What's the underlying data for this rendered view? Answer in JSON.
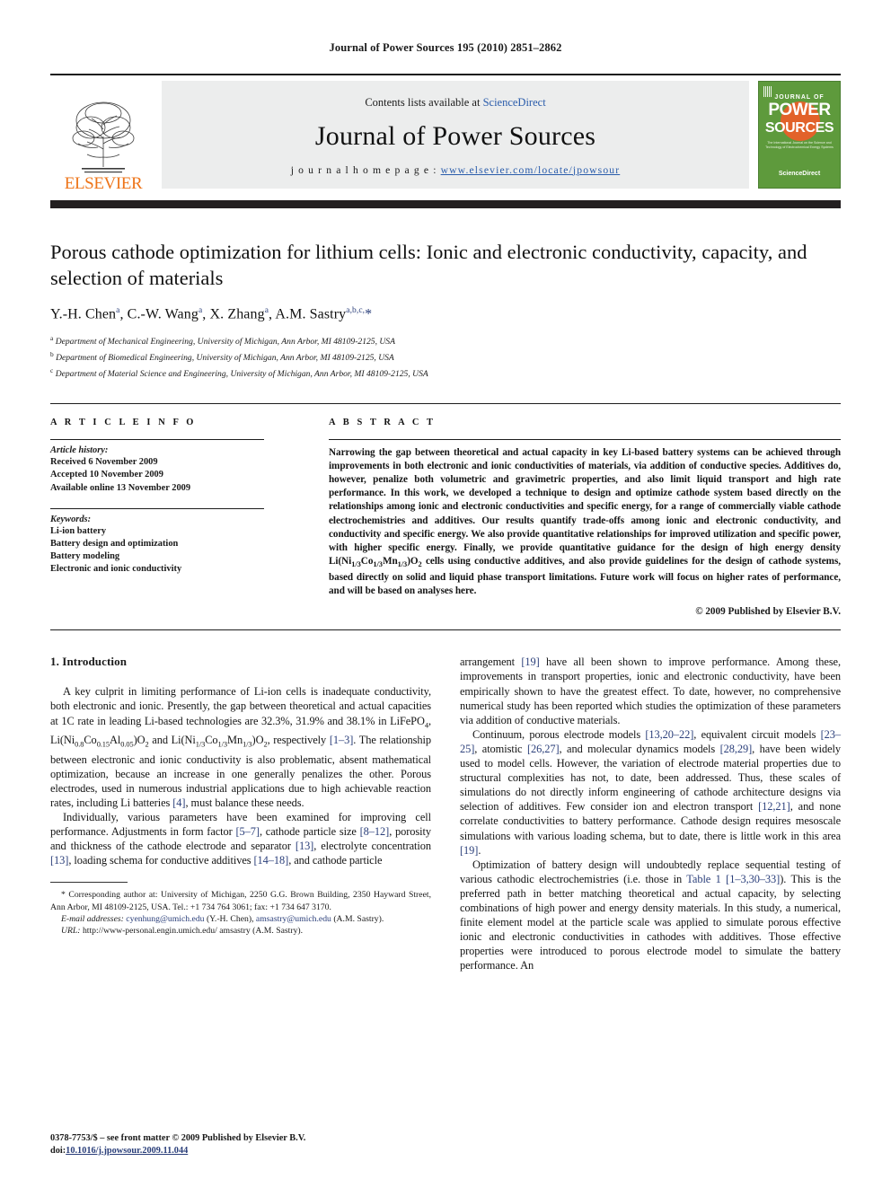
{
  "running_head": "Journal of Power Sources 195 (2010) 2851–2862",
  "masthead": {
    "publisher_name": "ELSEVIER",
    "contents_prefix": "Contents lists available at ",
    "sciencedirect": "ScienceDirect",
    "journal_title": "Journal of Power Sources",
    "homepage_prefix": "j o u r n a l   h o m e p a g e :  ",
    "homepage_url": "www.elsevier.com/locate/jpowsour",
    "cover": {
      "journal_of": "JOURNAL OF",
      "power": "POWER",
      "sources": "SOURCES",
      "subtitle": "The International Journal on the Science and Technology of Electrochemical Energy Systems",
      "sciencedirect": "ScienceDirect",
      "green": "#5e9a3c",
      "orange": "#e2622a"
    }
  },
  "article": {
    "title": "Porous cathode optimization for lithium cells: Ionic and electronic conductivity, capacity, and selection of materials",
    "authors_html": "Y.-H. Chen<sup>a</sup>, C.-W. Wang<sup>a</sup>, X. Zhang<sup>a</sup>, A.M. Sastry<sup>a,b,c,</sup><span class=\"star\">*</span>",
    "affiliations": [
      {
        "mark": "a",
        "text": "Department of Mechanical Engineering, University of Michigan, Ann Arbor, MI 48109-2125, USA"
      },
      {
        "mark": "b",
        "text": "Department of Biomedical Engineering, University of Michigan, Ann Arbor, MI 48109-2125, USA"
      },
      {
        "mark": "c",
        "text": "Department of Material Science and Engineering, University of Michigan, Ann Arbor, MI 48109-2125, USA"
      }
    ]
  },
  "article_info": {
    "label": "A R T I C L E    I N F O",
    "history_head": "Article history:",
    "history": [
      "Received 6 November 2009",
      "Accepted 10 November 2009",
      "Available online 13 November 2009"
    ],
    "keywords_head": "Keywords:",
    "keywords": [
      "Li-ion battery",
      "Battery design and optimization",
      "Battery modeling",
      "Electronic and ionic conductivity"
    ]
  },
  "abstract": {
    "label": "A B S T R A C T",
    "html": "Narrowing the gap between theoretical and actual capacity in key Li-based battery systems can be achieved through improvements in both electronic and ionic conductivities of materials, via addition of conductive species. Additives do, however, penalize both volumetric and gravimetric properties, and also limit liquid transport and high rate performance. In this work, we developed a technique to design and optimize cathode system based directly on the relationships among ionic and electronic conductivities and specific energy, for a range of commercially viable cathode electrochemistries and additives. Our results quantify trade-offs among ionic and electronic conductivity, and conductivity and specific energy. We also provide quantitative relationships for improved utilization and specific power, with higher specific energy. Finally, we provide quantitative guidance for the design of high energy density Li(Ni<sub>1/3</sub>Co<sub>1/3</sub>Mn<sub>1/3</sub>)O<sub>2</sub> cells using conductive additives, and also provide guidelines for the design of cathode systems, based directly on solid and liquid phase transport limitations. Future work will focus on higher rates of performance, and will be based on analyses here.",
    "copyright": "© 2009 Published by Elsevier B.V."
  },
  "body": {
    "section_heading": "1.  Introduction",
    "left_paragraphs_html": [
      "A key culprit in limiting performance of Li-ion cells is inadequate conductivity, both electronic and ionic. Presently, the gap between theoretical and actual capacities at 1C rate in leading Li-based technologies are 32.3%, 31.9% and 38.1% in LiFePO<sub>4</sub>, Li(Ni<sub>0.8</sub>Co<sub>0.15</sub>Al<sub>0.05</sub>)O<sub>2</sub> and Li(Ni<sub>1/3</sub>Co<sub>1/3</sub>Mn<sub>1/3</sub>)O<sub>2</sub>, respectively <span class=\"ref\">[1–3]</span>. The relationship between electronic and ionic conductivity is also problematic, absent mathematical optimization, because an increase in one generally penalizes the other. Porous electrodes, used in numerous industrial applications due to high achievable reaction rates, including Li batteries <span class=\"ref\">[4]</span>, must balance these needs.",
      "Individually, various parameters have been examined for improving cell performance. Adjustments in form factor <span class=\"ref\">[5–7]</span>, cathode particle size <span class=\"ref\">[8–12]</span>, porosity and thickness of the cathode electrode and separator <span class=\"ref\">[13]</span>, electrolyte concentration <span class=\"ref\">[13]</span>, loading schema for conductive additives <span class=\"ref\">[14–18]</span>, and cathode particle"
    ],
    "right_paragraphs_html": [
      "arrangement <span class=\"ref\">[19]</span> have all been shown to improve performance. Among these, improvements in transport properties, ionic and electronic conductivity, have been empirically shown to have the greatest effect. To date, however, no comprehensive numerical study has been reported which studies the optimization of these parameters via addition of conductive materials.",
      "Continuum, porous electrode models <span class=\"ref\">[13,20–22]</span>, equivalent circuit models <span class=\"ref\">[23–25]</span>, atomistic <span class=\"ref\">[26,27]</span>, and molecular dynamics models <span class=\"ref\">[28,29]</span>, have been widely used to model cells. However, the variation of electrode material properties due to structural complexities has not, to date, been addressed. Thus, these scales of simulations do not directly inform engineering of cathode architecture designs via selection of additives. Few consider ion and electron transport <span class=\"ref\">[12,21]</span>, and none correlate conductivities to battery performance. Cathode design requires mesoscale simulations with various loading schema, but to date, there is little work in this area <span class=\"ref\">[19]</span>.",
      "Optimization of battery design will undoubtedly replace sequential testing of various cathodic electrochemistries (i.e. those in <span class=\"ref\">Table 1</span> <span class=\"ref\">[1–3,30–33]</span>). This is the preferred path in better matching theoretical and actual capacity, by selecting combinations of high power and energy density materials. In this study, a numerical, finite element model at the particle scale was applied to simulate porous effective ionic and electronic conductivities in cathodes with additives. Those effective properties were introduced to porous electrode model to simulate the battery performance. An"
    ]
  },
  "footnote": {
    "corresponding_html": "*  Corresponding author at: University of Michigan, 2250 G.G. Brown Building, 2350 Hayward Street, Ann Arbor, MI 48109-2125, USA. Tel.: +1 734 764 3061; fax: +1 734 647 3170.",
    "email_html": "<i>E-mail addresses:</i> <span class=\"mail\">cyenhung@umich.edu</span> (Y.-H. Chen), <span class=\"mail\">amsastry@umich.edu</span> (A.M. Sastry).",
    "url_html": "<i>URL:</i> http://www-personal.engin.umich.edu/ amsastry (A.M. Sastry)."
  },
  "footer": {
    "issn_line": "0378-7753/$ – see front matter © 2009 Published by Elsevier B.V.",
    "doi_prefix": "doi:",
    "doi_value": "10.1016/j.jpowsour.2009.11.044"
  }
}
